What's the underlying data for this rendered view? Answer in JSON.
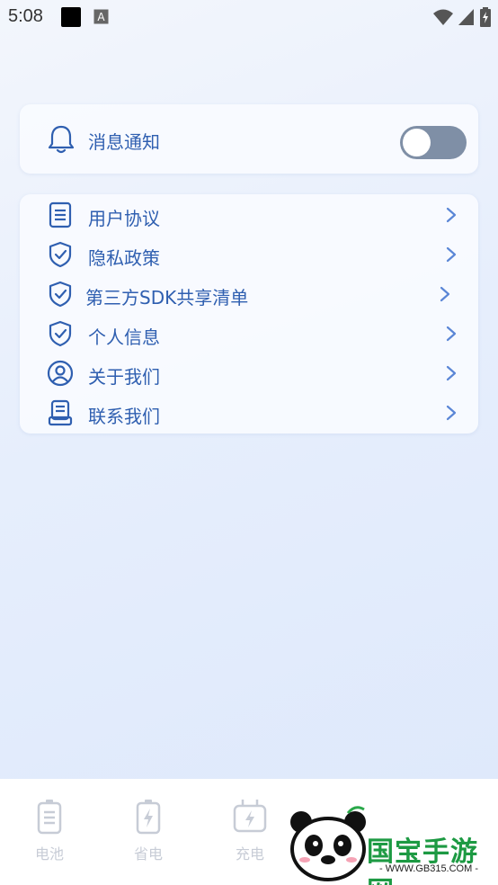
{
  "status_bar": {
    "time": "5:08",
    "icons": [
      "black-square-icon",
      "a-keyboard-icon",
      "wifi-icon",
      "signal-icon",
      "battery-icon"
    ]
  },
  "notification": {
    "label": "消息通知",
    "toggle_on": false
  },
  "menu": {
    "items": [
      {
        "label": "用户协议",
        "icon": "document-icon"
      },
      {
        "label": "隐私政策",
        "icon": "shield-check-icon"
      },
      {
        "label": "第三方SDK共享清单",
        "icon": "shield-check-icon"
      },
      {
        "label": "个人信息",
        "icon": "shield-check-icon"
      },
      {
        "label": "关于我们",
        "icon": "user-circle-icon"
      },
      {
        "label": "联系我们",
        "icon": "contact-icon"
      }
    ]
  },
  "bottom_nav": {
    "tabs": [
      {
        "label": "电池",
        "icon": "battery-tab-icon"
      },
      {
        "label": "省电",
        "icon": "power-save-icon"
      },
      {
        "label": "充电",
        "icon": "charging-icon"
      }
    ]
  },
  "watermark": {
    "title": "国宝手游网",
    "url": "- WWW.GB315.COM -"
  },
  "colors": {
    "accent": "#2f5fb0",
    "toggle_off": "#7f8fa6",
    "tab_inactive": "#c7ccd6",
    "watermark_green": "#1d9a43"
  }
}
